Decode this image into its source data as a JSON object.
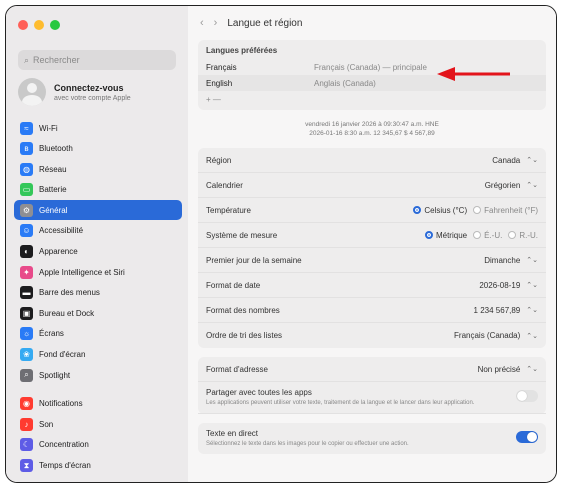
{
  "window": {
    "title": "Langue et région",
    "traffic": {
      "close": "#ff5f57",
      "min": "#febc2e",
      "max": "#28c840"
    }
  },
  "sidebar": {
    "search_placeholder": "Rechercher",
    "account_title": "Connectez-vous",
    "account_sub": "avec votre compte Apple",
    "items": [
      {
        "label": "Wi-Fi",
        "icon": "wifi-icon",
        "color": "#2a7bf6",
        "glyph": "≈"
      },
      {
        "label": "Bluetooth",
        "icon": "bluetooth-icon",
        "color": "#2a7bf6",
        "glyph": "ʙ"
      },
      {
        "label": "Réseau",
        "icon": "globe-icon",
        "color": "#2a7bf6",
        "glyph": "◍"
      },
      {
        "label": "Batterie",
        "icon": "battery-icon",
        "color": "#34c759",
        "glyph": "▭"
      },
      {
        "label": "Général",
        "icon": "gear-icon",
        "color": "#8e8e93",
        "glyph": "⚙",
        "active": true
      },
      {
        "label": "Accessibilité",
        "icon": "accessibility-icon",
        "color": "#2a7bf6",
        "glyph": "☺"
      },
      {
        "label": "Apparence",
        "icon": "appearance-icon",
        "color": "#1c1c1e",
        "glyph": "◐"
      },
      {
        "label": "Apple Intelligence et Siri",
        "icon": "siri-icon",
        "color": "#e84a8a",
        "glyph": "✦"
      },
      {
        "label": "Barre des menus",
        "icon": "menubar-icon",
        "color": "#1c1c1e",
        "glyph": "▬"
      },
      {
        "label": "Bureau et Dock",
        "icon": "dock-icon",
        "color": "#1c1c1e",
        "glyph": "▣"
      },
      {
        "label": "Écrans",
        "icon": "display-icon",
        "color": "#2a7bf6",
        "glyph": "☼"
      },
      {
        "label": "Fond d'écran",
        "icon": "wallpaper-icon",
        "color": "#35aaf2",
        "glyph": "❀"
      },
      {
        "label": "Spotlight",
        "icon": "spotlight-icon",
        "color": "#6e6e73",
        "glyph": "⌕"
      },
      {
        "label": "Notifications",
        "icon": "notifications-icon",
        "color": "#ff3b30",
        "glyph": "◉",
        "gap_before": true
      },
      {
        "label": "Son",
        "icon": "sound-icon",
        "color": "#ff3b30",
        "glyph": "♪"
      },
      {
        "label": "Concentration",
        "icon": "focus-icon",
        "color": "#5e5ce6",
        "glyph": "☾"
      },
      {
        "label": "Temps d'écran",
        "icon": "screentime-icon",
        "color": "#5e5ce6",
        "glyph": "⧗"
      }
    ]
  },
  "main": {
    "preferred_title": "Langues préférées",
    "languages": [
      {
        "name": "Français",
        "detail": "Français (Canada) — principale"
      },
      {
        "name": "English",
        "detail": "Anglais (Canada)"
      }
    ],
    "plus_minus": "+  —",
    "format_preview_1": "vendredi 16 janvier 2026 à 09:30:47 a.m. HNE",
    "format_preview_2": "2026-01-16 8:30 a.m.   12 345,67 $   4 567,89",
    "rows": {
      "region_label": "Région",
      "region_value": "Canada",
      "calendar_label": "Calendrier",
      "calendar_value": "Grégorien",
      "temperature_label": "Température",
      "temp_celsius": "Celsius (°C)",
      "temp_fahrenheit": "Fahrenheit (°F)",
      "measure_label": "Système de mesure",
      "measure_metric": "Métrique",
      "measure_us": "É.-U.",
      "measure_uk": "R.-U.",
      "firstday_label": "Premier jour de la semaine",
      "firstday_value": "Dimanche",
      "dateformat_label": "Format de date",
      "dateformat_value": "2026-08-19",
      "numberformat_label": "Format des nombres",
      "numberformat_value": "1 234 567,89",
      "sortorder_label": "Ordre de tri des listes",
      "sortorder_value": "Français (Canada)"
    },
    "address_label": "Format d'adresse",
    "address_value": "Non précisé",
    "share_title": "Partager avec toutes les apps",
    "share_desc": "Les applications peuvent utiliser votre texte, traitement de la langue et le lancer dans leur application.",
    "live_title": "Texte en direct",
    "live_desc": "Sélectionnez le texte dans les images pour le copier ou effectuer une action."
  },
  "annotation": {
    "arrow_color": "#e3141b"
  }
}
